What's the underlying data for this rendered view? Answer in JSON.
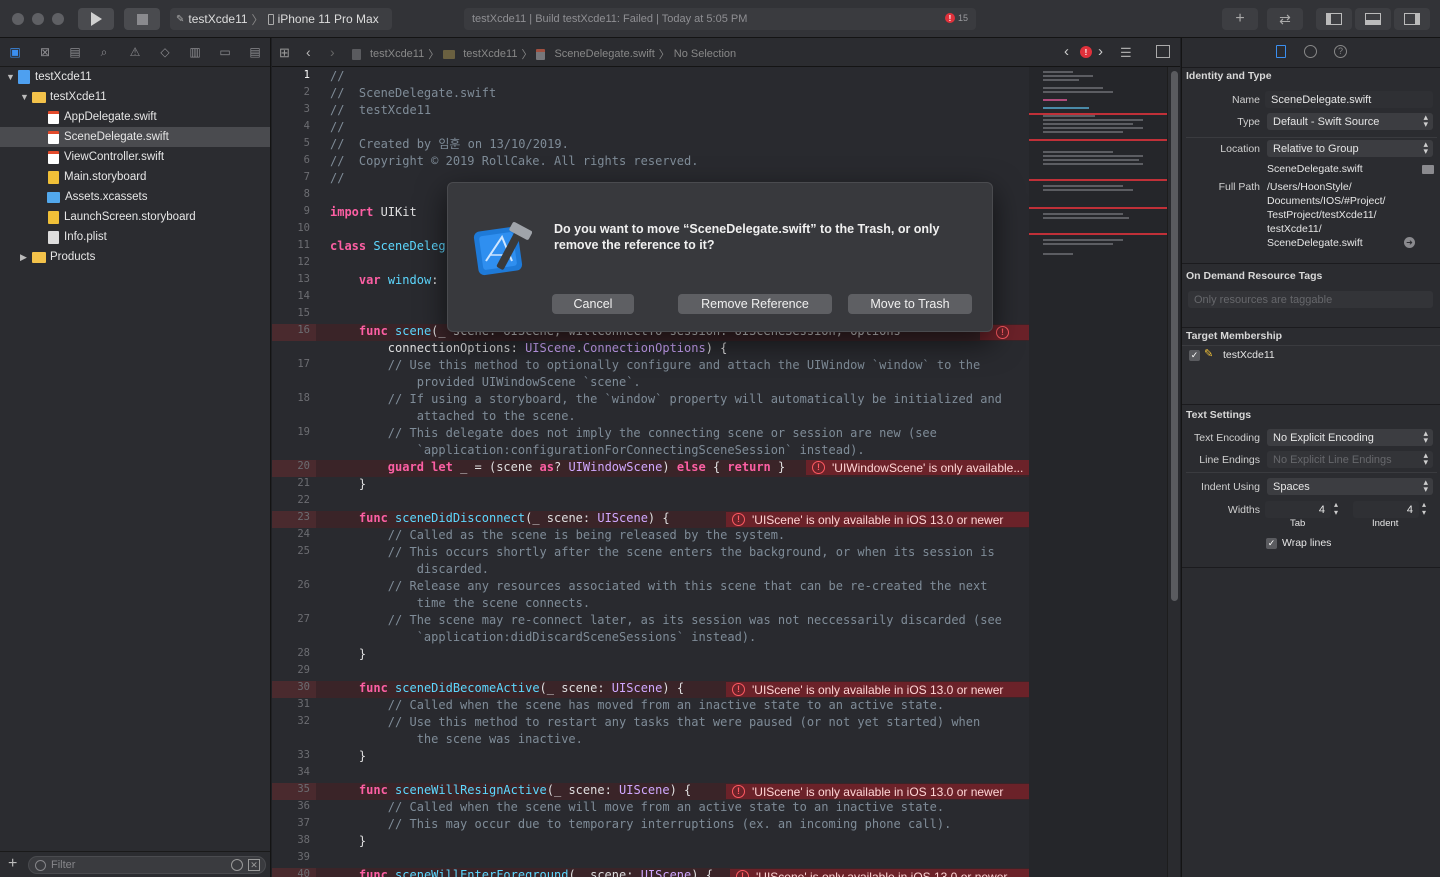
{
  "toolbar": {
    "scheme_target": "testXcde11",
    "scheme_device": "iPhone 11 Pro Max",
    "activity_text": "testXcde11 | Build testXcde11: Failed | Today at 5:05 PM",
    "error_count": "15"
  },
  "navigator": {
    "items": [
      {
        "label": "testXcde11"
      },
      {
        "label": "testXcde11"
      },
      {
        "label": "AppDelegate.swift"
      },
      {
        "label": "SceneDelegate.swift"
      },
      {
        "label": "ViewController.swift"
      },
      {
        "label": "Main.storyboard"
      },
      {
        "label": "Assets.xcassets"
      },
      {
        "label": "LaunchScreen.storyboard"
      },
      {
        "label": "Info.plist"
      },
      {
        "label": "Products"
      }
    ],
    "filter_placeholder": "Filter"
  },
  "jumpbar": {
    "crumbs": [
      "testXcde11",
      "testXcde11",
      "SceneDelegate.swift",
      "No Selection"
    ]
  },
  "editor": {
    "line_numbers": [
      "1",
      "2",
      "3",
      "4",
      "5",
      "6",
      "7",
      "8",
      "9",
      "10",
      "11",
      "12",
      "13",
      "14",
      "15",
      "16",
      "17",
      "18",
      "19",
      "20",
      "21",
      "22",
      "23",
      "24",
      "25",
      "26",
      "27",
      "28",
      "29",
      "30",
      "31",
      "32",
      "33",
      "34",
      "35",
      "36",
      "37",
      "38",
      "39",
      "40"
    ],
    "errors": {
      "uiwindowscene": "'UIWindowScene' is only available...",
      "uiscene": "'UIScene' is only available in iOS 13.0 or newer"
    }
  },
  "dialog": {
    "message": "Do you want to move “SceneDelegate.swift” to the Trash, or only remove the reference to it?",
    "cancel": "Cancel",
    "remove_reference": "Remove Reference",
    "move_to_trash": "Move to Trash"
  },
  "inspector": {
    "identity_header": "Identity and Type",
    "name_label": "Name",
    "name_value": "SceneDelegate.swift",
    "type_label": "Type",
    "type_value": "Default - Swift Source",
    "location_label": "Location",
    "location_value": "Relative to Group",
    "location_file": "SceneDelegate.swift",
    "fullpath_label": "Full Path",
    "fullpath_lines": [
      "/Users/HoonStyle/",
      "Documents/IOS/#Project/",
      "TestProject/testXcde11/",
      "testXcde11/",
      "SceneDelegate.swift"
    ],
    "odr_header": "On Demand Resource Tags",
    "odr_placeholder": "Only resources are taggable",
    "target_header": "Target Membership",
    "target_name": "testXcde11",
    "text_header": "Text Settings",
    "encoding_label": "Text Encoding",
    "encoding_value": "No Explicit Encoding",
    "endings_label": "Line Endings",
    "endings_value": "No Explicit Line Endings",
    "indent_label": "Indent Using",
    "indent_value": "Spaces",
    "widths_label": "Widths",
    "tab_value": "4",
    "indent_width_value": "4",
    "tab_caption": "Tab",
    "indent_caption": "Indent",
    "wrap_label": "Wrap lines"
  }
}
